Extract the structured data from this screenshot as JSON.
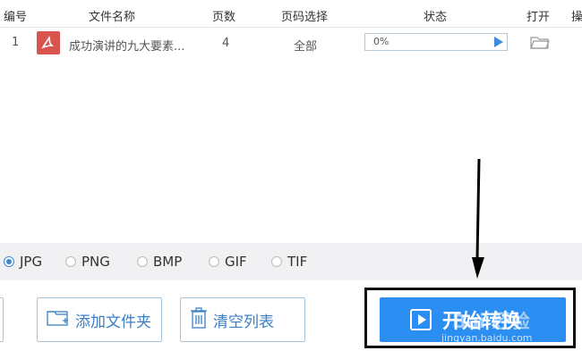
{
  "table": {
    "columns": [
      "编号",
      "文件名称",
      "页数",
      "页码选择",
      "状态",
      "打开",
      "操"
    ],
    "rows": [
      {
        "index": "1",
        "file_name": "成功演讲的九大要素...",
        "pages": "4",
        "page_selection": "全部",
        "status_pct": "0%",
        "progress_value": 0
      }
    ]
  },
  "formats": {
    "options": [
      "JPG",
      "PNG",
      "BMP",
      "GIF",
      "TIF"
    ],
    "selected": "JPG"
  },
  "buttons": {
    "add_folder": "添加文件夹",
    "clear_list": "清空列表",
    "start": "开始转换"
  },
  "watermark": {
    "text": "jingyan.baidu.com",
    "logo": "Bai 经验"
  },
  "colors": {
    "accent": "#2b8ef2",
    "pdf_red": "#d9534f",
    "format_bar": "#f1f1f3"
  }
}
